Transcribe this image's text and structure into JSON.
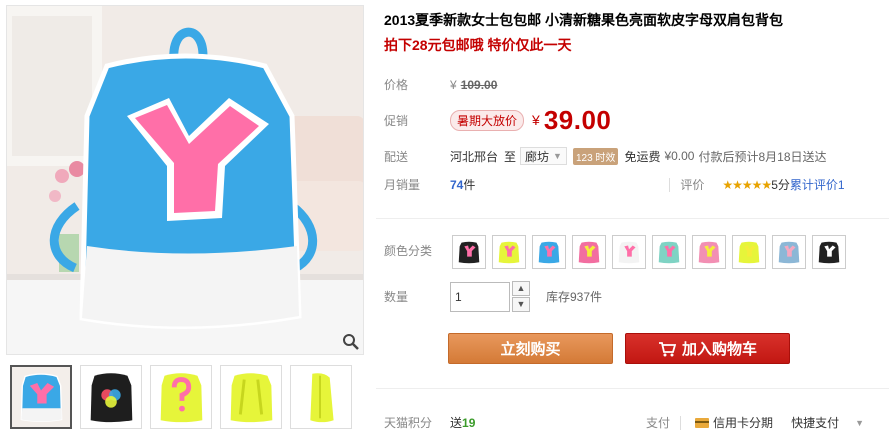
{
  "product": {
    "title": "2013夏季新款女士包包邮 小清新糖果色亮面软皮字母双肩包背包",
    "subtitle": "拍下28元包邮哦 特价仅此一天"
  },
  "price": {
    "label": "价格",
    "currency": "¥",
    "original": "109.00"
  },
  "promo": {
    "label": "促销",
    "tag": "暑期大放价",
    "currency": "¥",
    "price": "39.00"
  },
  "shipping": {
    "label": "配送",
    "origin": "河北邢台",
    "to": "至",
    "destination": "廊坊",
    "time_badge": "123 时效",
    "fee": "免运费",
    "fee_value": "¥0.00",
    "eta": "付款后预计8月18日送达"
  },
  "sales": {
    "label": "月销量",
    "count": "74",
    "unit": "件",
    "rating_label": "评价",
    "stars": "★★★★★",
    "score": "5分",
    "reviews": "累计评价1"
  },
  "color": {
    "label": "颜色分类",
    "swatches": [
      {
        "name": "black-pink",
        "body": "#222222",
        "accent": "#ff6fa8"
      },
      {
        "name": "yellow-pink",
        "body": "#e6f53a",
        "accent": "#ff6fa8"
      },
      {
        "name": "blue-pink",
        "body": "#3aa8e6",
        "accent": "#ff6fa8"
      },
      {
        "name": "pink-yellow",
        "body": "#f26ea0",
        "accent": "#f4ee3a"
      },
      {
        "name": "white-pink",
        "body": "#f3f3f3",
        "accent": "#ff6fa8"
      },
      {
        "name": "mint-pink",
        "body": "#7fd3c4",
        "accent": "#ff6fa8"
      },
      {
        "name": "pink-question",
        "body": "#f28fb3",
        "accent": "#f4ee3a"
      },
      {
        "name": "yellow-question",
        "body": "#e6f53a",
        "accent": "#f4ee3a"
      },
      {
        "name": "blue-grey",
        "body": "#8cb7d6",
        "accent": "#f5a8c0"
      },
      {
        "name": "black-question",
        "body": "#222222",
        "accent": "#ffffff"
      }
    ]
  },
  "quantity": {
    "label": "数量",
    "value": "1",
    "up": "▲",
    "down": "▼",
    "stock": "库存937件"
  },
  "actions": {
    "buy": "立刻购买",
    "cart": "加入购物车"
  },
  "footer": {
    "points_label": "天猫积分",
    "points_prefix": "送",
    "points_value": "19",
    "pay_label": "支付",
    "credit": "信用卡分期",
    "quick_pay": "快捷支付"
  },
  "gallery": {
    "thumbnails": [
      "blue-pink",
      "black-rainbow",
      "yellow-question",
      "yellow-back",
      "yellow-side"
    ]
  },
  "colors": {
    "accent_red": "#c40000",
    "buy_orange": "#d47a37",
    "cart_red": "#c21712",
    "bag_blue": "#3aa8e6",
    "bag_pink": "#ff6fa8"
  }
}
